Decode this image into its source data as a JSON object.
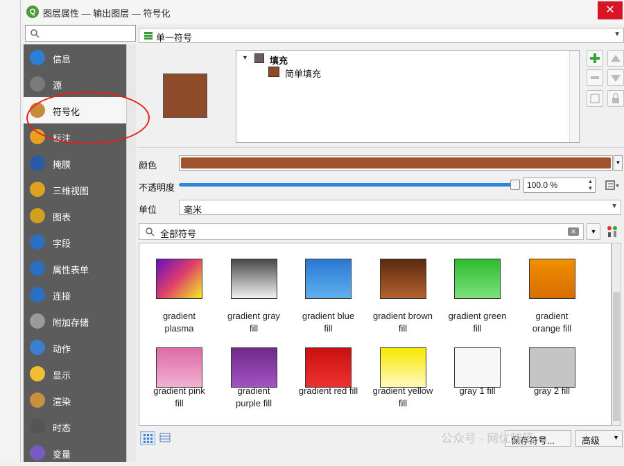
{
  "window": {
    "title": "图层属性 — 输出图层 — 符号化",
    "close_label": "✕"
  },
  "sidebar": {
    "search_placeholder": "",
    "items": [
      {
        "label": "信息",
        "icon": "info-icon"
      },
      {
        "label": "源",
        "icon": "source-icon"
      },
      {
        "label": "符号化",
        "icon": "paintbrush-icon",
        "selected": true
      },
      {
        "label": "标注",
        "icon": "abc-label-icon"
      },
      {
        "label": "掩膜",
        "icon": "abc-mask-icon"
      },
      {
        "label": "三维视图",
        "icon": "cube-icon"
      },
      {
        "label": "图表",
        "icon": "diagram-icon"
      },
      {
        "label": "字段",
        "icon": "fields-icon"
      },
      {
        "label": "属性表单",
        "icon": "form-icon"
      },
      {
        "label": "连接",
        "icon": "join-icon"
      },
      {
        "label": "附加存储",
        "icon": "storage-icon"
      },
      {
        "label": "动作",
        "icon": "action-icon"
      },
      {
        "label": "显示",
        "icon": "display-icon"
      },
      {
        "label": "渲染",
        "icon": "render-icon"
      },
      {
        "label": "时态",
        "icon": "clock-icon"
      },
      {
        "label": "变量",
        "icon": "variable-icon"
      }
    ]
  },
  "renderer": {
    "label": "单一符号"
  },
  "tree": {
    "root": "填充",
    "child": "简单填充"
  },
  "colors": {
    "fill": "#a0522d",
    "preview": "#8e4b29",
    "sidebar_bg": "#5c5c5c",
    "accent": "#2f86d6"
  },
  "props": {
    "color_label": "颜色",
    "opacity_label": "不透明度",
    "opacity_value": "100.0 %",
    "opacity_fraction": 1.0,
    "unit_label": "单位",
    "unit_value": "毫米"
  },
  "filter": {
    "label": "全部符号"
  },
  "symbols": [
    {
      "name": "gradient\nplasma",
      "c1": "#6a0fbe",
      "c2": "#f0f020",
      "dir": "135deg",
      "mid": "#e0406a"
    },
    {
      "name": "gradient  gray\nfill",
      "c1": "#4a4a4a",
      "c2": "#f2f2f2",
      "dir": "180deg"
    },
    {
      "name": "gradient blue\nfill",
      "c1": "#2a78d2",
      "c2": "#60b0ee",
      "dir": "180deg"
    },
    {
      "name": "gradient brown\nfill",
      "c1": "#5a2a10",
      "c2": "#b5612d",
      "dir": "180deg"
    },
    {
      "name": "gradient green\nfill",
      "c1": "#2ebc2e",
      "c2": "#7de07d",
      "dir": "180deg"
    },
    {
      "name": "gradient\norange fill",
      "c1": "#f09000",
      "c2": "#d86c00",
      "dir": "180deg"
    },
    {
      "name": "gradient pink\nfill",
      "c1": "#dd6aa6",
      "c2": "#f2b2d2",
      "dir": "180deg"
    },
    {
      "name": "gradient\npurple fill",
      "c1": "#6e2a8a",
      "c2": "#a453c2",
      "dir": "180deg"
    },
    {
      "name": "gradient red fill",
      "c1": "#c81010",
      "c2": "#ef3030",
      "dir": "180deg"
    },
    {
      "name": "gradient yellow\nfill",
      "c1": "#f8e800",
      "c2": "#fffac0",
      "dir": "180deg"
    },
    {
      "name": "gray 1 fill",
      "c1": "#f7f7f7",
      "c2": "#f7f7f7",
      "dir": "180deg"
    },
    {
      "name": "gray 2 fill",
      "c1": "#c5c5c5",
      "c2": "#c5c5c5",
      "dir": "180deg"
    }
  ],
  "footer": {
    "save_symbol": "保存符号...",
    "advanced": "高级",
    "watermark": "公众号 · 网优随笔"
  }
}
